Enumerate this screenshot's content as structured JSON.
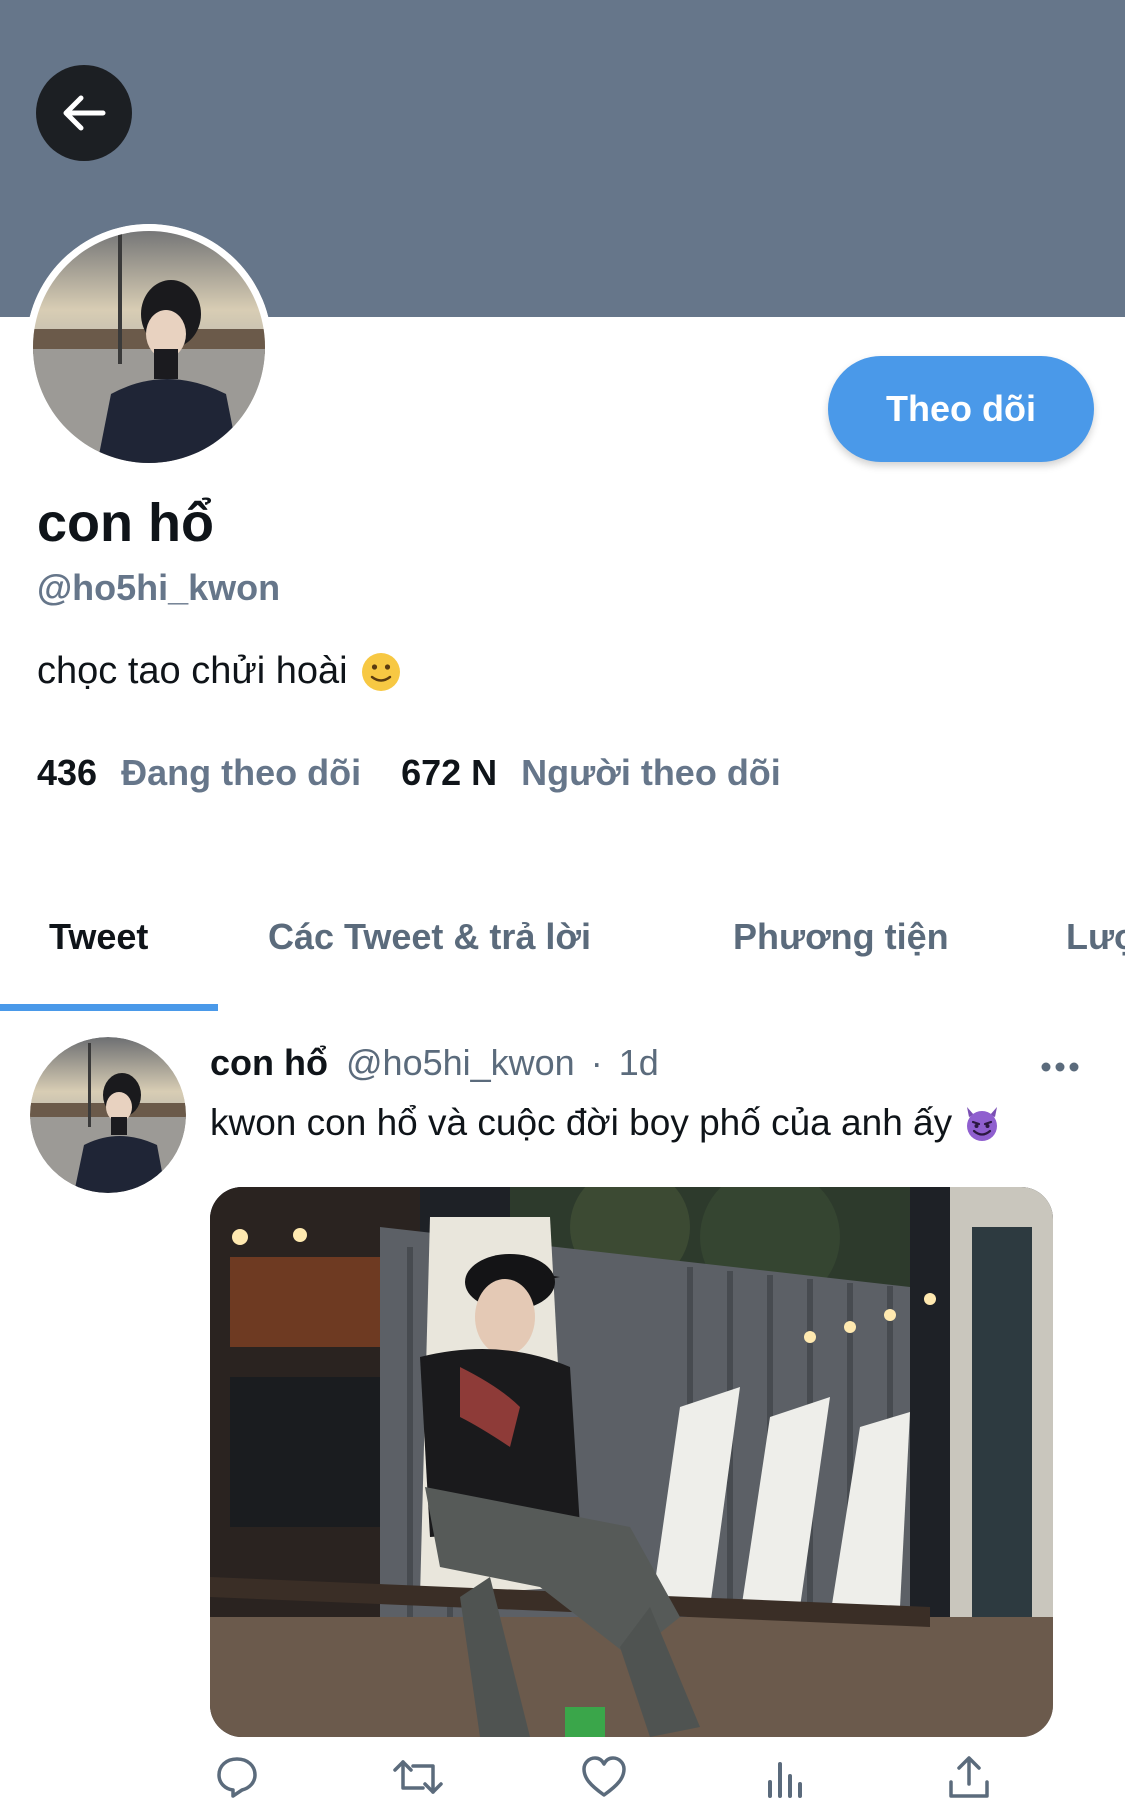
{
  "profile": {
    "display_name": "con hổ",
    "handle": "@ho5hi_kwon",
    "bio": "chọc tao chửi hoài",
    "bio_emoji": "slightly-smiling-face-emoji",
    "follow_button_label": "Theo dõi",
    "following_count": "436",
    "following_label": "Đang theo dõi",
    "followers_count": "672 N",
    "followers_label": "Người theo dõi"
  },
  "tabs": [
    {
      "label": "Tweet",
      "active": true
    },
    {
      "label": "Các Tweet & trả lời",
      "active": false
    },
    {
      "label": "Phương tiện",
      "active": false
    },
    {
      "label": "Lượt thích",
      "active": false
    }
  ],
  "tweet": {
    "name": "con hổ",
    "handle": "@ho5hi_kwon",
    "separator": "·",
    "time": "1d",
    "text": "kwon con hổ và cuộc đời boy phố của anh ấy",
    "text_emoji": "smiling-face-with-horns-emoji",
    "media_description": "photo-of-man-sitting-on-bench-by-container-at-night"
  },
  "icons": {
    "back": "arrow-left-icon",
    "more": "more-horizontal-icon",
    "reply": "reply-icon",
    "retweet": "retweet-icon",
    "like": "heart-icon",
    "analytics": "analytics-icon",
    "share": "share-icon"
  },
  "colors": {
    "banner": "#66768a",
    "accent": "#4a99e9",
    "text_primary": "#0f1419",
    "text_secondary": "#5b6b7c",
    "back_button": "#1c1f23"
  }
}
